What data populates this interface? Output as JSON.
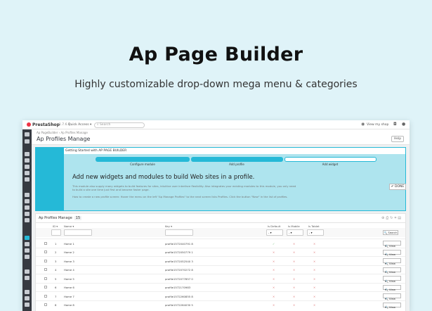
{
  "hero": {
    "title": "Ap Page Builder",
    "subtitle": "Highly customizable drop-down mega menu & categories"
  },
  "topbar": {
    "logo": "PrestaShop",
    "version": "1.7.6.1",
    "quick_access": "Quick Access ▾",
    "search_placeholder": "Search",
    "view_shop": "View my shop"
  },
  "header": {
    "breadcrumb_1": "Ap PageBuilder",
    "breadcrumb_2": "Ap Profiles Manage",
    "page_title": "Ap Profiles Manage",
    "help_label": "Help"
  },
  "getting_started": {
    "header": "Getting Started with AP PAGE BUILDER",
    "steps": [
      "Configure module",
      "Add profile",
      "Add widget"
    ],
    "title": "Add new widgets and modules to build Web sites in a profile.",
    "text1": "This module also supply many widgets to build features for sites, intuitive user interface flexibility. Also integrates your existing modules to this module, you only need to build a site one time just first and become faster page.",
    "text2": "How to create a new profile screen: Hover the menu on the left \"Ap Manage Profiles\" to the next screen lists Profiles. Click the button \"New\" in the list of profiles.",
    "done_label": "✔ DONE"
  },
  "list": {
    "title": "Ap Profiles Manage",
    "count": "15",
    "columns": [
      "ID ▾",
      "Name ▾",
      "Key ▾",
      "Is Default",
      "Is Mobile",
      "Is Tablet"
    ],
    "search_label": "🔍 Search",
    "filter_select": "-",
    "view_label": "🔍 View",
    "rows": [
      {
        "id": "1",
        "name": "Home 1",
        "key": "profile1572040791 8",
        "default": "✓",
        "mobile": "✕",
        "tablet": "✕"
      },
      {
        "id": "2",
        "name": "Home 2",
        "key": "profile1572050779 1",
        "default": "✕",
        "mobile": "✕",
        "tablet": "✕"
      },
      {
        "id": "3",
        "name": "Home 3",
        "key": "profile1572052540 3",
        "default": "✕",
        "mobile": "✕",
        "tablet": "✕"
      },
      {
        "id": "4",
        "name": "Home 4",
        "key": "profile1572070272 8",
        "default": "✕",
        "mobile": "✕",
        "tablet": "✕"
      },
      {
        "id": "5",
        "name": "Home 5",
        "key": "profile1572077857 0",
        "default": "✕",
        "mobile": "✕",
        "tablet": "✕"
      },
      {
        "id": "6",
        "name": "Home 6",
        "key": "profile1572170983",
        "default": "✕",
        "mobile": "✕",
        "tablet": "✕"
      },
      {
        "id": "7",
        "name": "Home 7",
        "key": "profile1572260855 8",
        "default": "✕",
        "mobile": "✕",
        "tablet": "✕"
      },
      {
        "id": "8",
        "name": "Home 8",
        "key": "profile1572264030 5",
        "default": "✕",
        "mobile": "✕",
        "tablet": "✕"
      }
    ]
  },
  "colors": {
    "accent": "#25b9d7",
    "sidebar": "#363a41",
    "background": "#dff3f8"
  }
}
